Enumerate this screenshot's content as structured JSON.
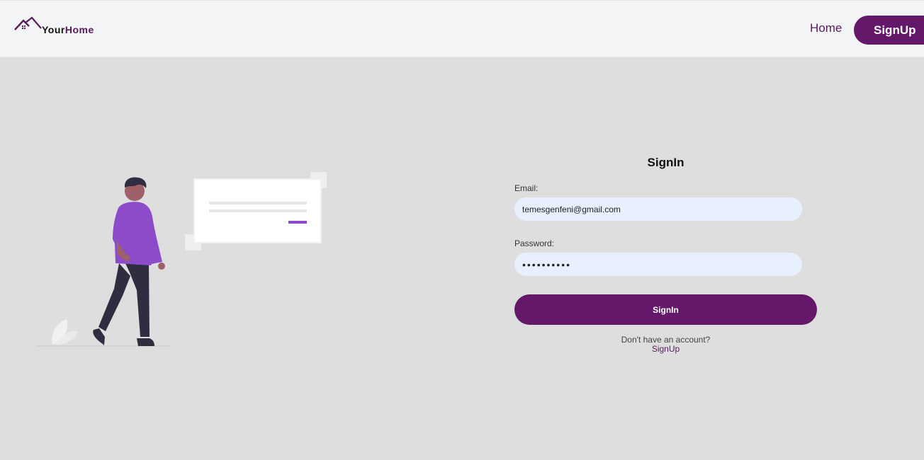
{
  "brand": {
    "name_part1": "Your",
    "name_part2": "Home",
    "logo_icon": "house-roof-icon"
  },
  "nav": {
    "home_label": "Home",
    "signup_label": "SignUp"
  },
  "form": {
    "title": "SignIn",
    "email": {
      "label": "Email:",
      "value": "temesgenfeni@gmail.com"
    },
    "password": {
      "label": "Password:",
      "value": "••••••••••"
    },
    "submit_label": "SignIn",
    "no_account_text": "Don't have an account?",
    "signup_link": "SignUp"
  },
  "illustration": {
    "icon": "person-with-message-card-illustration"
  },
  "colors": {
    "brand_purple": "#641869",
    "accent_purple": "#8c4bc9",
    "input_background": "#e8f0fe",
    "page_background": "#dedede",
    "navbar_background": "#f3f4f6"
  }
}
